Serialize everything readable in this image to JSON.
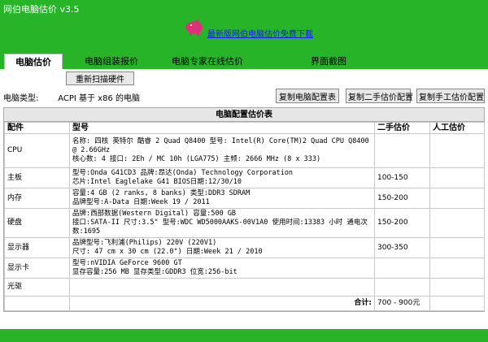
{
  "app": {
    "title": "网伯电脑估价 v3.5",
    "download_link": "最新版网伯电脑估价免费下载"
  },
  "tabs": [
    {
      "label": "电脑估价",
      "active": true
    },
    {
      "label": "电脑组装报价"
    },
    {
      "label": "电脑专家在线估价"
    },
    {
      "label": "界面截图"
    }
  ],
  "toolbar": {
    "rescan_label": "重新扫描硬件",
    "type_label": "电脑类型:",
    "type_value": "ACPI 基于 x86 的电脑",
    "copy_config_label": "复制电脑配置表",
    "copy_used_label": "复制二手估价配置",
    "copy_manual_label": "复制手工估价配置"
  },
  "table": {
    "title": "电脑配置估价表",
    "headers": [
      "配件",
      "型号",
      "二手估价",
      "人工估价"
    ],
    "rows": [
      {
        "part": "CPU",
        "lines": [
          "名称: 四核 英特尔 酷睿 2 Quad Q8400 型号: Intel(R) Core(TM)2 Quad CPU Q8400 @ 2.66GHz",
          "核心数: 4 接口: 2Eh / MC 10h (LGA775) 主频: 2666 MHz (8 x 333)"
        ],
        "used_price": "",
        "manual_price": ""
      },
      {
        "part": "主板",
        "lines": [
          "型号:Onda G41CD3 品牌:昂达(Onda) Technology Corporation",
          "芯片:Intel Eaglelake G41 BIOS日期:12/30/10"
        ],
        "used_price": "100-150",
        "manual_price": ""
      },
      {
        "part": "内存",
        "lines": [
          "容量:4 GB (2 ranks, 8 banks) 类型:DDR3 SDRAM",
          "品牌型号:A-Data 日期:Week 19 / 2011"
        ],
        "used_price": "150-200",
        "manual_price": ""
      },
      {
        "part": "硬盘",
        "lines": [
          "品牌:西部数据(Western Digital) 容量:500 GB",
          "接口:SATA-II 尺寸:3.5\" 型号:WDC WD5000AAKS-00V1A0 使用时间:13383 小时 通电次数:1695"
        ],
        "used_price": "150-200",
        "manual_price": ""
      },
      {
        "part": "显示器",
        "lines": [
          "品牌型号:飞利浦(Philips) 220V (220V1)",
          "尺寸: 47 cm x 30 cm (22.0\") 日期:Week 21 / 2010"
        ],
        "used_price": "300-350",
        "manual_price": ""
      },
      {
        "part": "显示卡",
        "lines": [
          "型号:nVIDIA GeForce 9600 GT",
          "显存容量:256 MB 显存类型:GDDR3 位宽:256-bit"
        ],
        "used_price": "",
        "manual_price": ""
      },
      {
        "part": "光驱",
        "lines": [],
        "used_price": "",
        "manual_price": ""
      }
    ],
    "total_label": "合计:",
    "total_value": "700 - 900元"
  },
  "colors": {
    "frame": "#28b428",
    "link": "#1a1aff"
  }
}
